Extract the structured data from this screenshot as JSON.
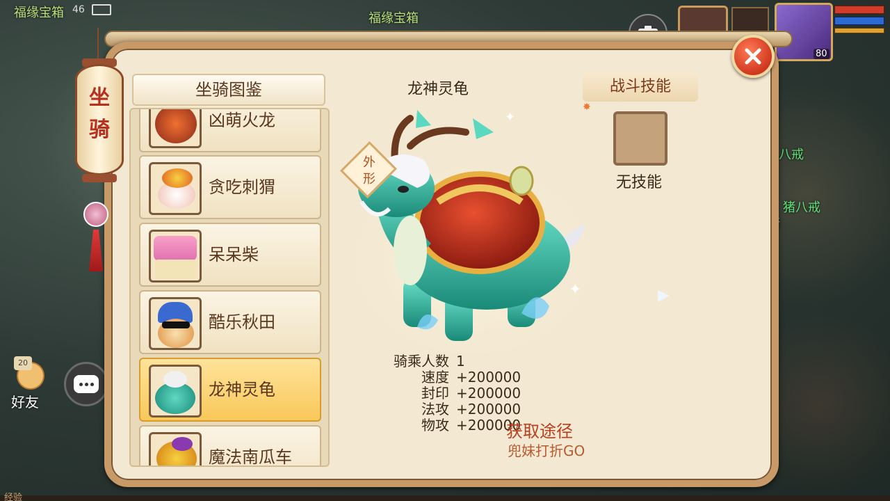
{
  "hud": {
    "top_left_text": "福缘宝箱",
    "signal": "46",
    "top_center_text": "福缘宝箱",
    "player_level": "80",
    "right_npc_1": "八戒",
    "right_npc_2": "猪八戒",
    "right_npc_3": "猪",
    "friends_badge": "20",
    "friends_label": "好友",
    "xp_label": "经验"
  },
  "lantern": {
    "text_1": "坐",
    "text_2": "骑"
  },
  "list": {
    "header": "坐骑图鉴",
    "items": [
      {
        "name": "凶萌火龙",
        "icon": "fire-dragon-icon",
        "selected": false
      },
      {
        "name": "贪吃刺猬",
        "icon": "hedgehog-icon",
        "selected": false
      },
      {
        "name": "呆呆柴",
        "icon": "shiba-icon",
        "selected": false
      },
      {
        "name": "酷乐秋田",
        "icon": "akita-icon",
        "selected": false
      },
      {
        "name": "龙神灵龟",
        "icon": "dragon-turtle-icon",
        "selected": true
      },
      {
        "name": "魔法南瓜车",
        "icon": "pumpkin-carriage-icon",
        "selected": false
      }
    ]
  },
  "detail": {
    "title": "龙神灵龟",
    "appearance_tag": "外形",
    "skill_tab": "战斗技能",
    "skill_none": "无技能",
    "stats": [
      {
        "label": "骑乘人数",
        "value": "1"
      },
      {
        "label": "速度",
        "value": "+200000"
      },
      {
        "label": "封印",
        "value": "+200000"
      },
      {
        "label": "法攻",
        "value": "+200000"
      },
      {
        "label": "物攻",
        "value": "+200000"
      }
    ],
    "acquire_title": "获取途径",
    "acquire_link": "兜妹打折GO"
  },
  "colors": {
    "panel_bg": "#f3e8d2",
    "panel_border": "#c89a68",
    "selected_item": "#f8c85a",
    "accent_red": "#b8401e"
  }
}
